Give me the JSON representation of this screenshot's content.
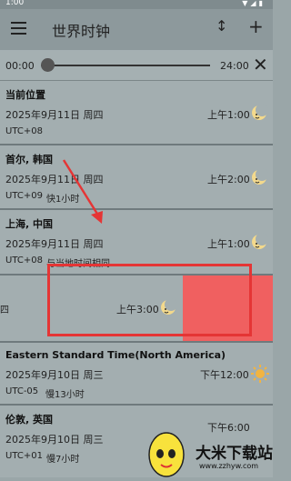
{
  "status": {
    "time": "1:00"
  },
  "appbar": {
    "title": "世界时钟",
    "sort_icon": "↕",
    "add_icon": "+"
  },
  "slider": {
    "start": "00:00",
    "end": "24:00",
    "close_icon": "✕",
    "value": 0
  },
  "clocks": [
    {
      "city": "当前位置",
      "date": "2025年9月11日 周四",
      "tz": "UTC+08",
      "diff": "",
      "time": "上午1:00",
      "icon": "moon-icon"
    },
    {
      "city": "首尔, 韩国",
      "date": "2025年9月11日 周四",
      "tz": "UTC+09",
      "diff": "快1小时",
      "time": "上午2:00",
      "icon": "moon-icon"
    },
    {
      "city": "上海, 中国",
      "date": "2025年9月11日 周四",
      "tz": "UTC+08",
      "diff": "与当地时间相同",
      "time": "上午1:00",
      "icon": "moon-icon"
    },
    {
      "city": "",
      "date": "",
      "tz": "",
      "diff": "",
      "time": "上午3:00",
      "icon": "moon-icon",
      "fragment": "四"
    },
    {
      "city": "Eastern Standard Time(North America)",
      "date": "2025年9月10日 周三",
      "tz": "UTC-05",
      "diff": "慢13小时",
      "time": "下午12:00",
      "icon": "sun-icon"
    },
    {
      "city": "伦敦, 英国",
      "date": "2025年9月10日 周三",
      "tz": "UTC+01",
      "diff": "慢7小时",
      "time": "下午6:00",
      "icon": "moon-icon"
    }
  ],
  "watermark": {
    "title": "大米下载站",
    "url": "www.zzhyw.com"
  }
}
